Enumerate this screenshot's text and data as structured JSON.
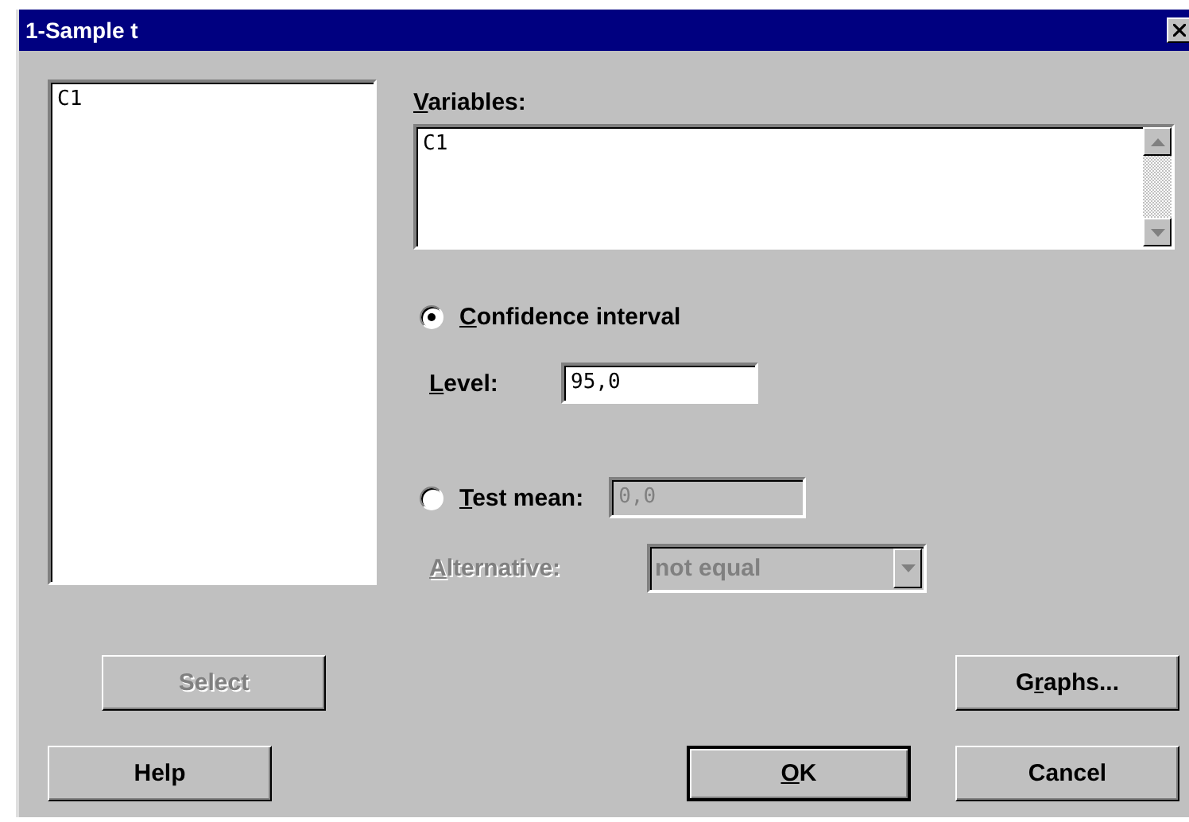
{
  "window": {
    "title": "1-Sample t"
  },
  "column_list": {
    "items": [
      "C1"
    ]
  },
  "variables": {
    "label": {
      "underlined": "V",
      "rest": "ariables:"
    },
    "value": "C1"
  },
  "options": [
    {
      "kind": "radio",
      "label": {
        "underlined": "C",
        "rest": "onfidence interval"
      },
      "selected": true
    },
    {
      "kind": "field",
      "label": {
        "underlined": "L",
        "rest": "evel:"
      },
      "value": "95,0",
      "disabled": false
    },
    {
      "kind": "radio",
      "label": {
        "underlined": "T",
        "rest": "est mean:"
      },
      "selected": false,
      "value": "0,0",
      "disabled": true
    },
    {
      "kind": "dropdown",
      "label": {
        "underlined": "A",
        "rest": "lternative:"
      },
      "value": "not equal",
      "disabled": true
    }
  ],
  "buttons": [
    {
      "label": {
        "rest": "Select"
      },
      "disabled": true,
      "default": false
    },
    {
      "label": {
        "before": "G",
        "underlined": "r",
        "rest": "aphs..."
      },
      "disabled": false,
      "default": false
    },
    {
      "label": {
        "rest": "Help"
      },
      "disabled": false,
      "default": false
    },
    {
      "label": {
        "underlined": "O",
        "rest": "K"
      },
      "disabled": false,
      "default": true
    },
    {
      "label": {
        "rest": "Cancel"
      },
      "disabled": false,
      "default": false
    }
  ]
}
